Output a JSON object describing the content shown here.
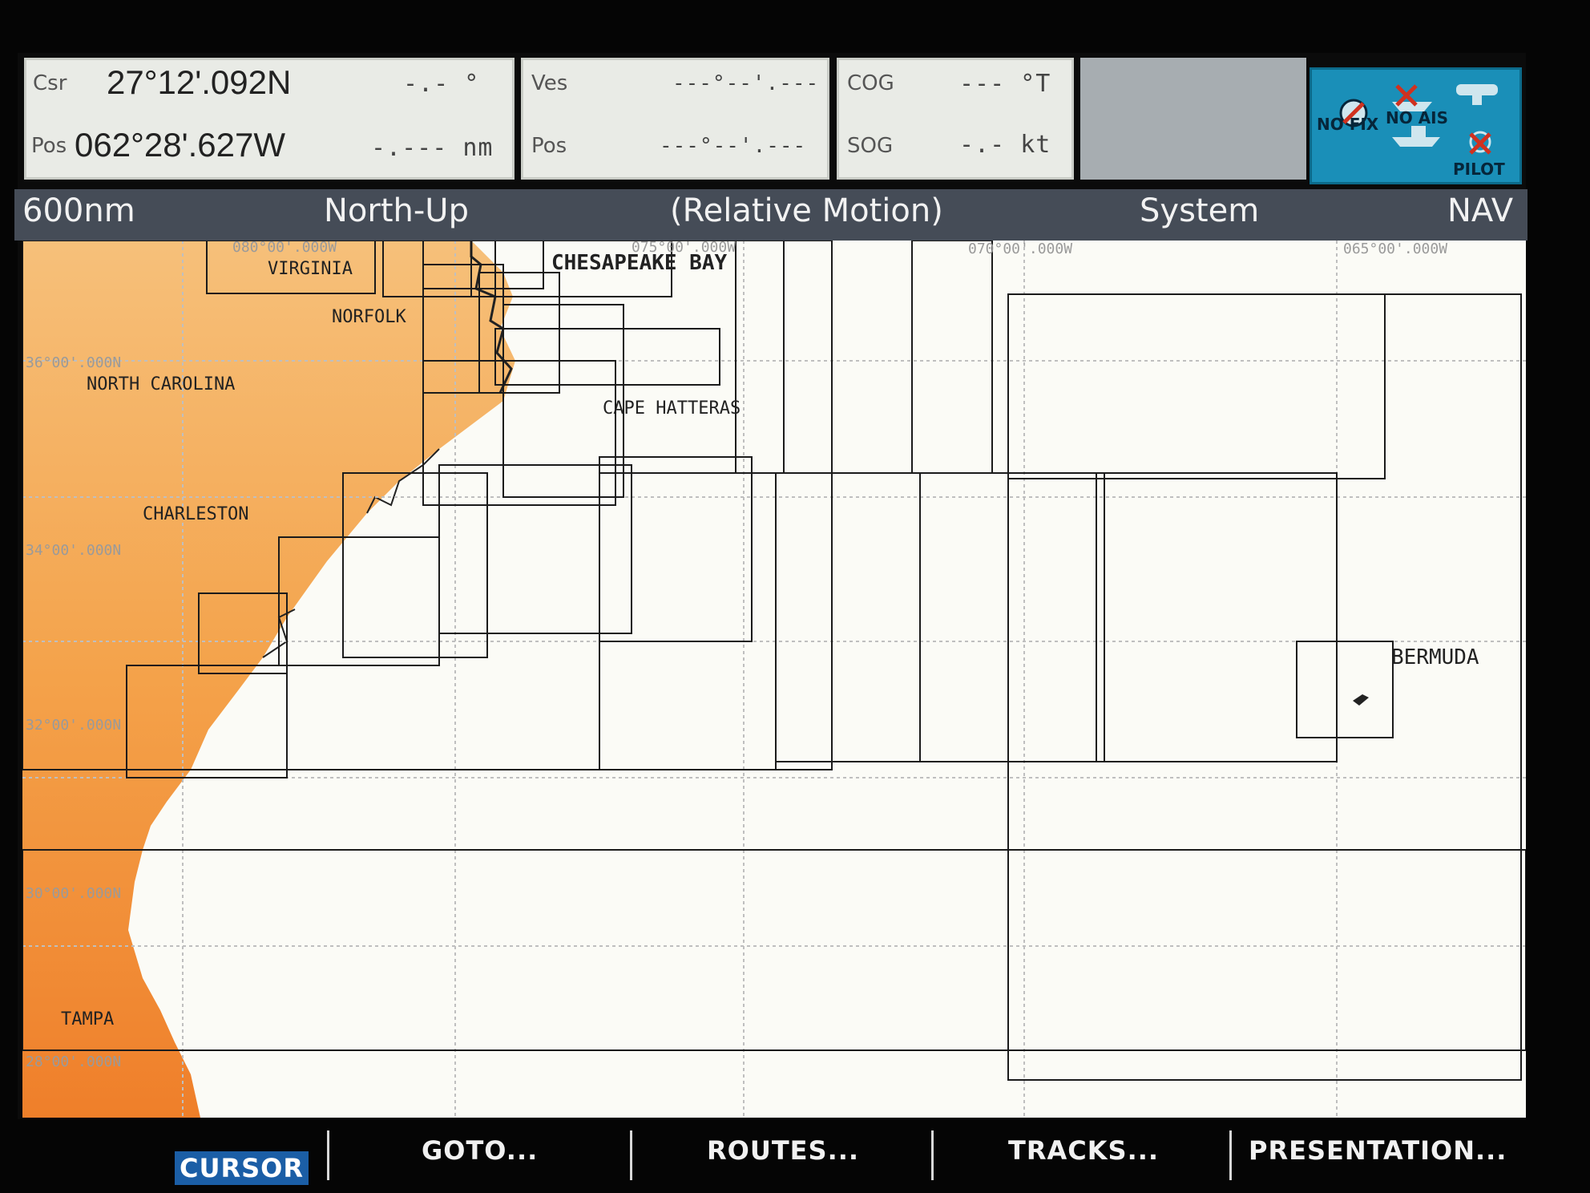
{
  "cursor": {
    "csr_label": "Csr",
    "pos_label": "Pos",
    "lat": "27°12'.092N",
    "lon": "062°28'.627W",
    "bearing": "-.- °",
    "range": "-.--- nm"
  },
  "vessel": {
    "ves_label": "Ves",
    "pos_label": "Pos",
    "lat": "---°--'.---",
    "lon": "---°--'.---"
  },
  "nav": {
    "cog_label": "COG",
    "sog_label": "SOG",
    "cog": "--- °T",
    "sog": "-.- kt"
  },
  "status": {
    "fix": "NO FIX",
    "ais": "NO AIS",
    "pilot": "PILOT"
  },
  "header": {
    "range": "600nm",
    "orientation": "North-Up",
    "motion": "(Relative Motion)",
    "data_source": "System",
    "mode": "NAV"
  },
  "chart": {
    "land_color": "#f4a24a",
    "sea_color": "#fbfbf6",
    "labels": {
      "virginia": "VIRGINIA",
      "norfolk": "NORFOLK",
      "chesapeake": "CHESAPEAKE BAY",
      "north_carolina": "NORTH CAROLINA",
      "cape_hatteras": "CAPE HATTERAS",
      "charleston": "CHARLESTON",
      "bermuda": "BERMUDA",
      "tampa": "TAMPA"
    },
    "grid_labels": {
      "lon_80": "080°00'.000W",
      "lon_75": "075°00'.000W",
      "lon_70": "070°00'.000W",
      "lon_65": "065°00'.000W",
      "lat_36": "36°00'.000N",
      "lat_34": "34°00'.000N",
      "lat_32": "32°00'.000N",
      "lat_30": "30°00'.000N",
      "lat_28": "28°00'.000N"
    }
  },
  "softkeys": {
    "cursor": "CURSOR",
    "goto": "GOTO...",
    "routes": "ROUTES...",
    "tracks": "TRACKS...",
    "presentation": "PRESENTATION..."
  }
}
